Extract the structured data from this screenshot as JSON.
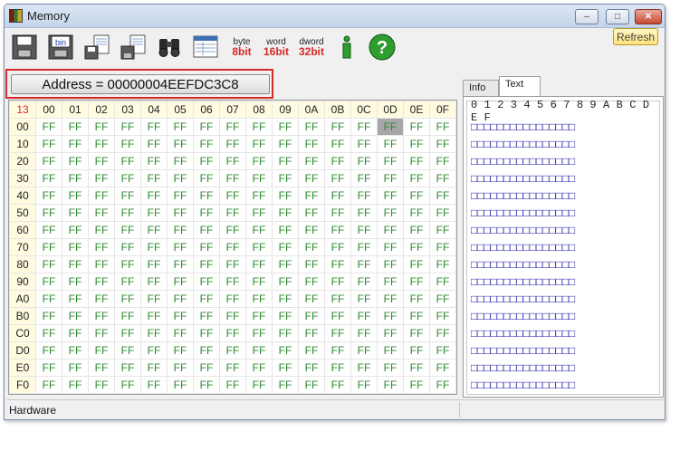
{
  "window": {
    "title": "Memory",
    "minimize": "–",
    "maximize": "□",
    "close": "✕"
  },
  "toolbar": {
    "items": [
      {
        "icon": "floppy-save-icon"
      },
      {
        "icon": "bin-floppy-icon",
        "label": "bin"
      },
      {
        "icon": "doc-save-icon"
      },
      {
        "icon": "doc-load-icon"
      },
      {
        "icon": "binoculars-icon"
      },
      {
        "icon": "table-window-icon"
      },
      {
        "icon": "byte-icon",
        "top": "byte",
        "bottom": "8bit",
        "color": "#d62a2a"
      },
      {
        "icon": "word-icon",
        "top": "word",
        "bottom": "16bit",
        "color": "#d62a2a"
      },
      {
        "icon": "dword-icon",
        "top": "dword",
        "bottom": "32bit",
        "color": "#d62a2a"
      },
      {
        "icon": "info-icon",
        "label": "i"
      },
      {
        "icon": "help-icon",
        "label": "?"
      }
    ],
    "refresh_label": "Refresh"
  },
  "address": {
    "label": "Address = 00000004EEFDC3C8"
  },
  "hex": {
    "corner": "13",
    "columns": [
      "00",
      "01",
      "02",
      "03",
      "04",
      "05",
      "06",
      "07",
      "08",
      "09",
      "0A",
      "0B",
      "0C",
      "0D",
      "0E",
      "0F"
    ],
    "rows": [
      "00",
      "10",
      "20",
      "30",
      "40",
      "50",
      "60",
      "70",
      "80",
      "90",
      "A0",
      "B0",
      "C0",
      "D0",
      "E0",
      "F0"
    ],
    "cell_value": "FF",
    "selected": {
      "row": 0,
      "col": 13
    }
  },
  "tabs": [
    {
      "label": "Info",
      "active": false
    },
    {
      "label": "Text",
      "active": true
    }
  ],
  "text_pane": {
    "header": "0 1 2 3 4 5 6 7 8 9 A B C D E F",
    "glyph": "□",
    "row_count": 16
  },
  "status": {
    "left": "Hardware"
  }
}
